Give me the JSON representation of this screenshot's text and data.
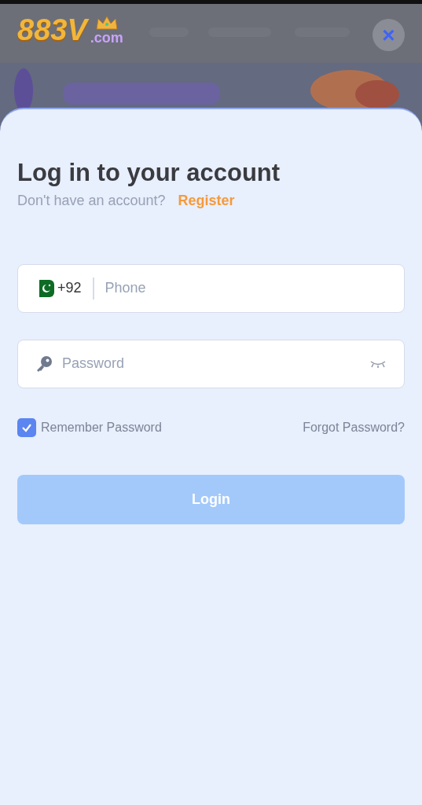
{
  "header": {
    "logo_number": "883V",
    "logo_suffix": ".com",
    "close_icon": "×"
  },
  "login": {
    "title": "Log in to your account",
    "prompt": "Don't have an account?",
    "register_link": "Register",
    "phone": {
      "country_code": "+92",
      "placeholder": "Phone"
    },
    "password": {
      "placeholder": "Password"
    },
    "remember": {
      "label": "Remember Password",
      "checked": true
    },
    "forgot_link": "Forgot Password?",
    "login_button": {
      "label": "Login",
      "disabled": true
    }
  }
}
